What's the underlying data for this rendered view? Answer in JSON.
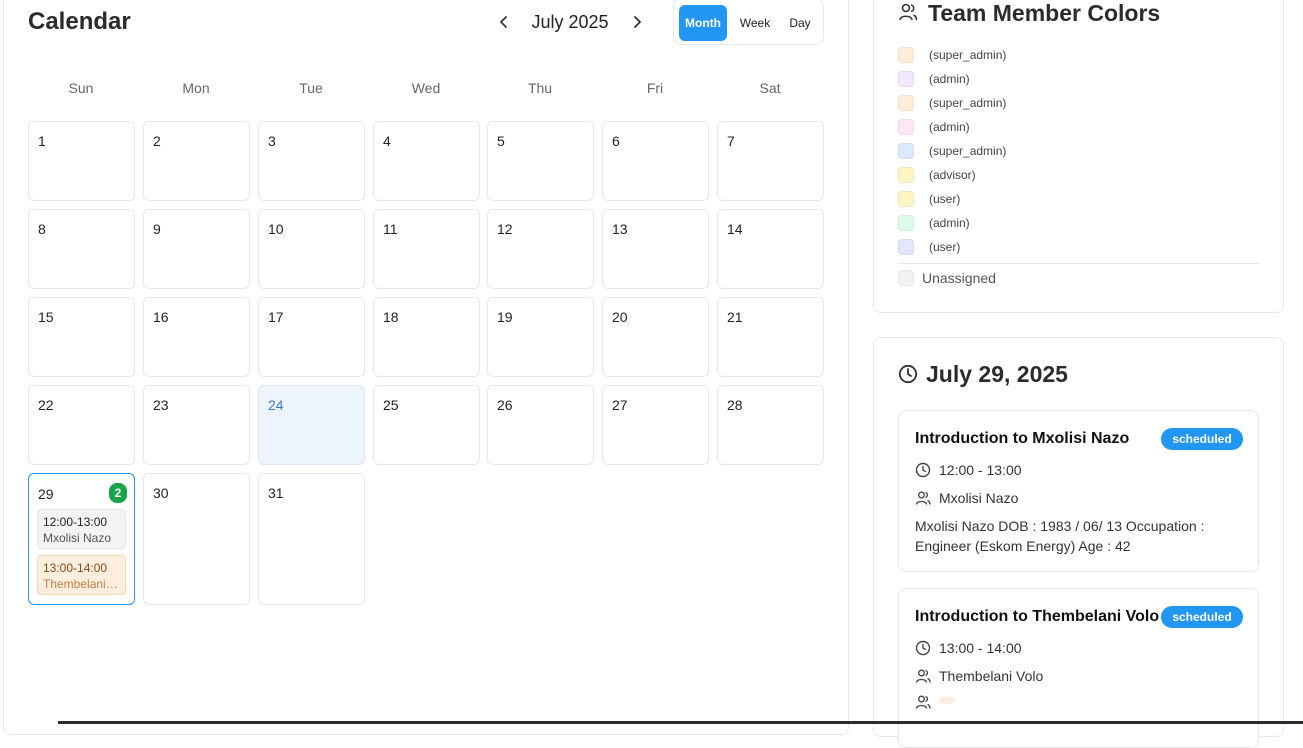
{
  "calendar": {
    "title": "Calendar",
    "month_label": "July 2025",
    "views": [
      "Month",
      "Week",
      "Day"
    ],
    "active_view": "Month",
    "weekdays": [
      "Sun",
      "Mon",
      "Tue",
      "Wed",
      "Thu",
      "Fri",
      "Sat"
    ],
    "days": [
      "1",
      "2",
      "3",
      "4",
      "5",
      "6",
      "7",
      "8",
      "9",
      "10",
      "11",
      "12",
      "13",
      "14",
      "15",
      "16",
      "17",
      "18",
      "19",
      "20",
      "21",
      "22",
      "23",
      "24",
      "25",
      "26",
      "27",
      "28",
      "29",
      "30",
      "31"
    ],
    "today": "24",
    "selected": "29",
    "selected_count": "2",
    "selected_events": [
      {
        "time": "12:00-13:00",
        "person": "Mxolisi Nazo"
      },
      {
        "time": "13:00-14:00",
        "person": "Thembelani Volo"
      }
    ]
  },
  "legend": {
    "title": "Team Member Colors",
    "entries": [
      {
        "role": "(super_admin)",
        "color": "#ffedd9"
      },
      {
        "role": "(admin)",
        "color": "#f3e8ff"
      },
      {
        "role": "(super_admin)",
        "color": "#ffedd9"
      },
      {
        "role": "(admin)",
        "color": "#fde7f3"
      },
      {
        "role": "(super_admin)",
        "color": "#dbeafe"
      },
      {
        "role": "(advisor)",
        "color": "#fef5c3"
      },
      {
        "role": "(user)",
        "color": "#fef5c3"
      },
      {
        "role": "(admin)",
        "color": "#dcfce7"
      },
      {
        "role": "(user)",
        "color": "#e0e7ff"
      }
    ],
    "unassigned_label": "Unassigned"
  },
  "day_detail": {
    "title": "July 29, 2025",
    "appointments": [
      {
        "title": "Introduction to Mxolisi Nazo",
        "status": "scheduled",
        "time": "12:00 - 13:00",
        "person": "Mxolisi Nazo",
        "description": "Mxolisi Nazo DOB : 1983 / 06/ 13 Occupation : Engineer (Eskom Energy) Age : 42"
      },
      {
        "title": "Introduction to Thembelani Volo",
        "status": "scheduled",
        "time": "13:00 - 14:00",
        "person": "Thembelani Volo"
      }
    ]
  },
  "colors": {
    "accent": "#2196f3",
    "today_bg": "#eef4fc",
    "badge_green": "#16a34a"
  },
  "icons": [
    "chevron-left-icon",
    "chevron-right-icon",
    "users-icon",
    "clock-icon",
    "user-icon"
  ]
}
